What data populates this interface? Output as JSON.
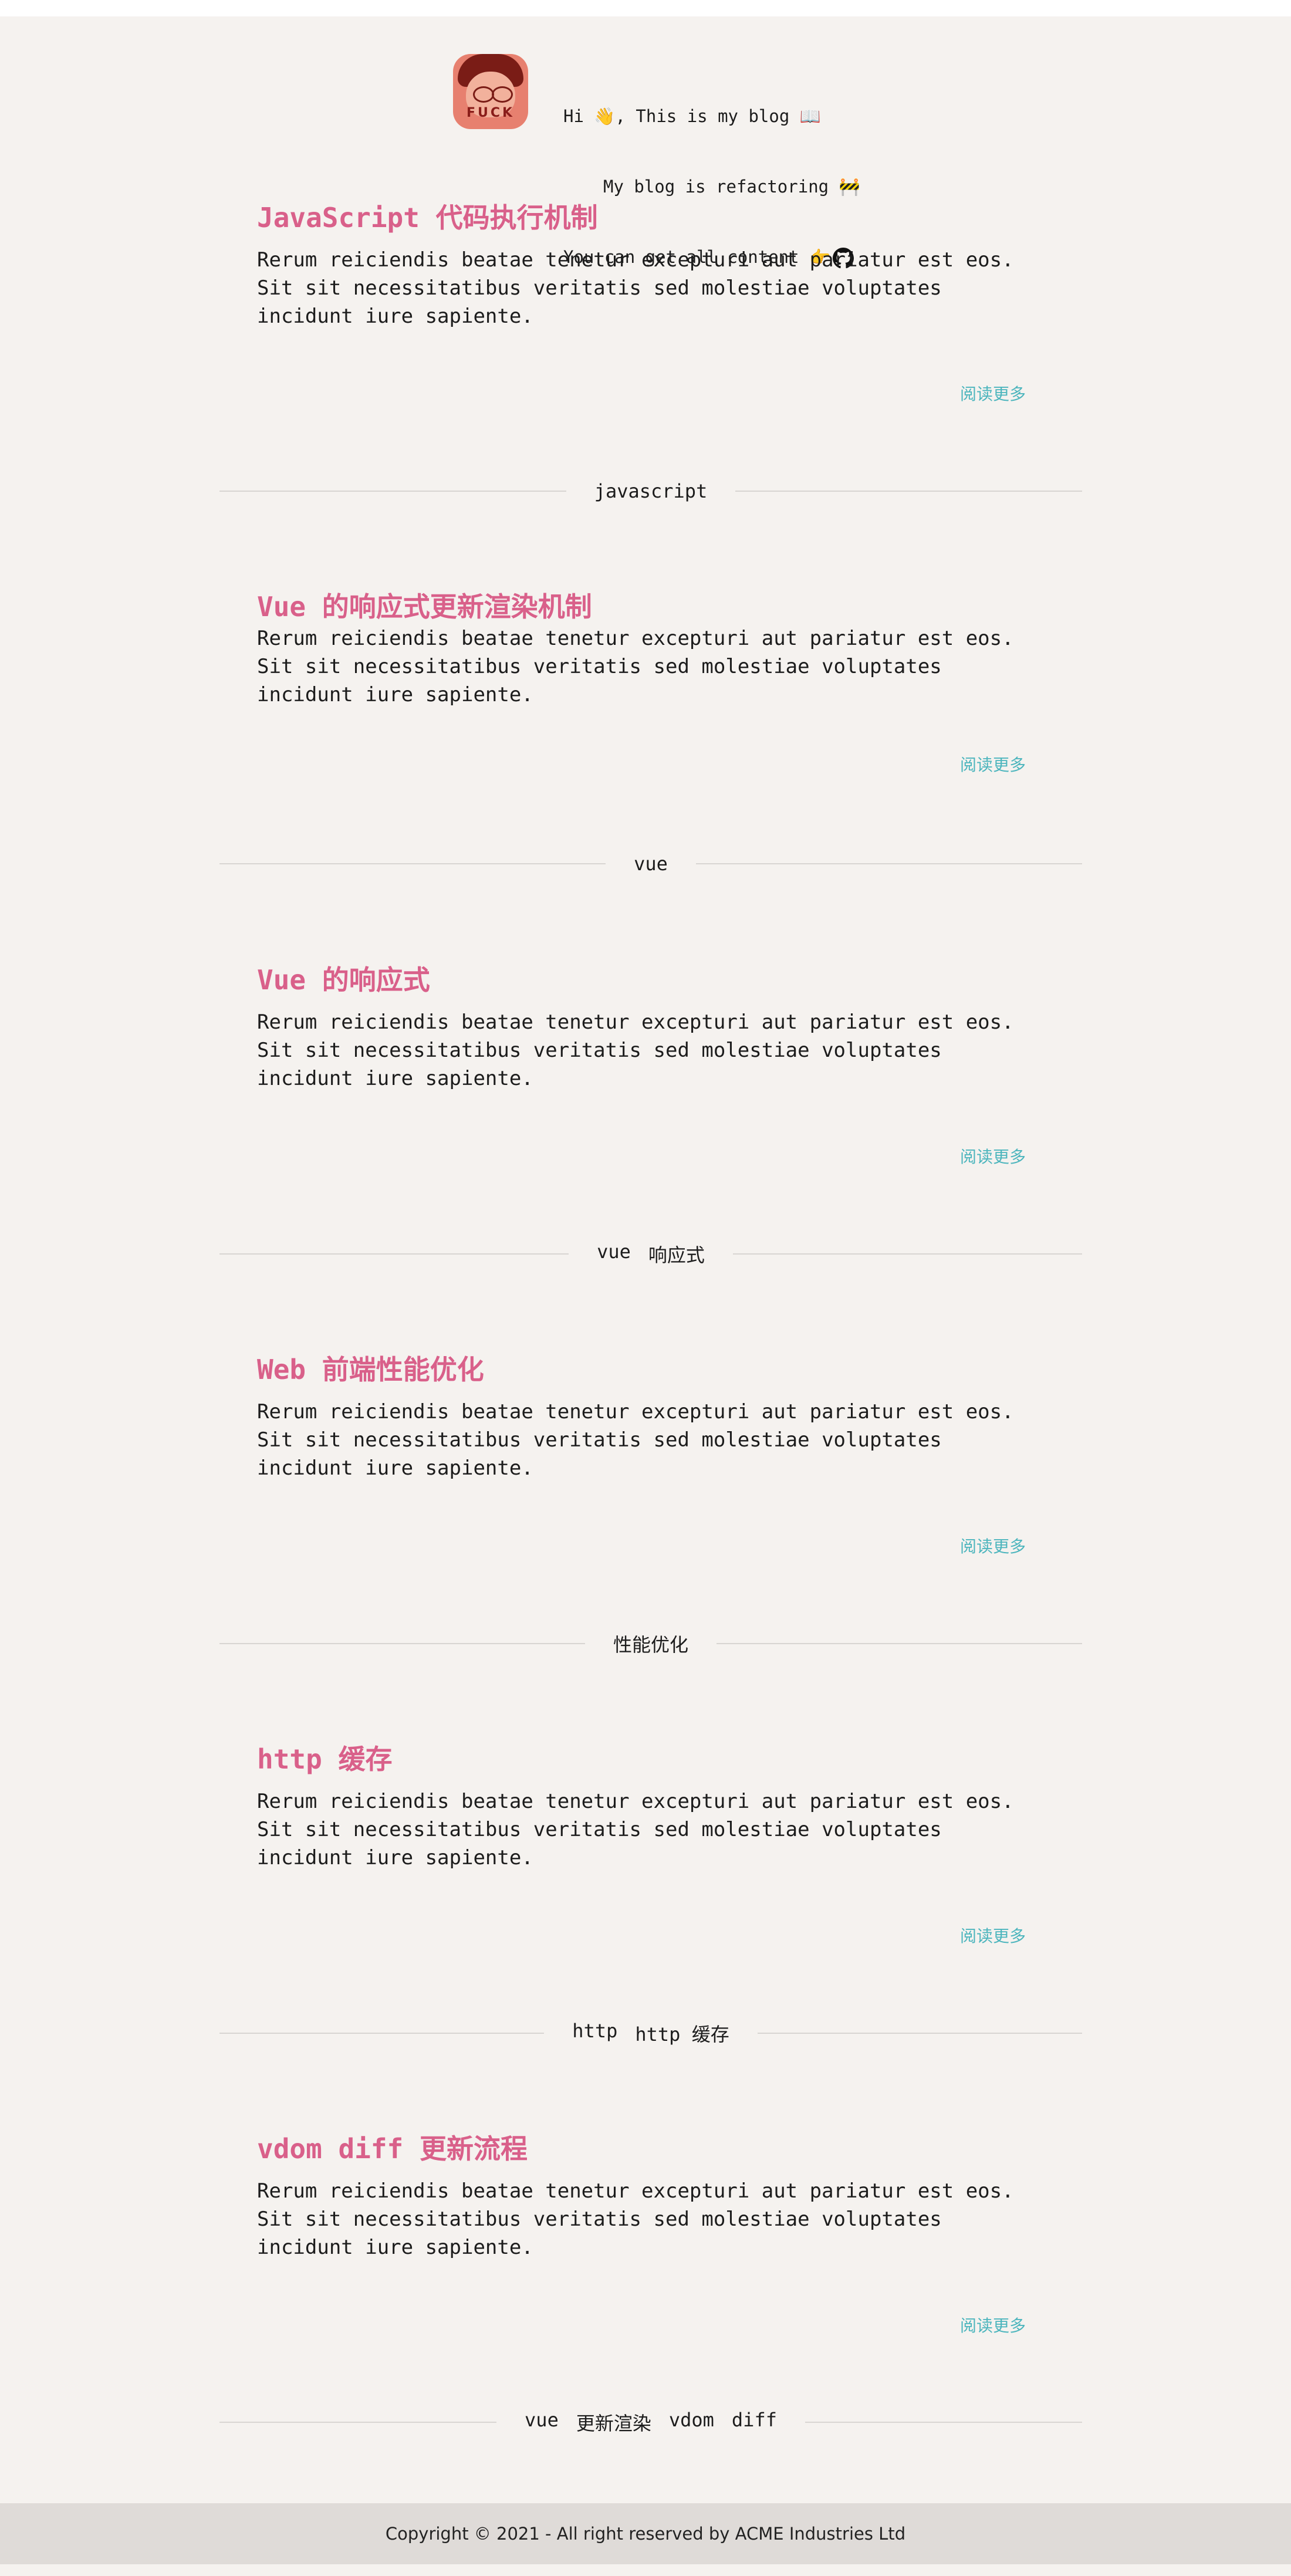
{
  "header": {
    "avatar_text": "FUCK",
    "intro_line1": "Hi 👋, This is my blog 📖",
    "intro_line2": "My blog is refactoring 🚧",
    "intro_line3": "You can get all content 👉"
  },
  "posts": [
    {
      "title": "JavaScript 代码执行机制",
      "excerpt": "Rerum reiciendis beatae tenetur excepturi aut pariatur est eos. Sit sit necessitatibus veritatis sed molestiae voluptates incidunt iure sapiente.",
      "read_more": "阅读更多",
      "tags": [
        "javascript"
      ]
    },
    {
      "title": "Vue 的响应式更新渲染机制",
      "excerpt": "Rerum reiciendis beatae tenetur excepturi aut pariatur est eos. Sit sit necessitatibus veritatis sed molestiae voluptates incidunt iure sapiente.",
      "read_more": "阅读更多",
      "tags": [
        "vue"
      ]
    },
    {
      "title": "Vue 的响应式",
      "excerpt": "Rerum reiciendis beatae tenetur excepturi aut pariatur est eos. Sit sit necessitatibus veritatis sed molestiae voluptates incidunt iure sapiente.",
      "read_more": "阅读更多",
      "tags": [
        "vue",
        "响应式"
      ]
    },
    {
      "title": "Web 前端性能优化",
      "excerpt": "Rerum reiciendis beatae tenetur excepturi aut pariatur est eos. Sit sit necessitatibus veritatis sed molestiae voluptates incidunt iure sapiente.",
      "read_more": "阅读更多",
      "tags": [
        "性能优化"
      ]
    },
    {
      "title": "http 缓存",
      "excerpt": "Rerum reiciendis beatae tenetur excepturi aut pariatur est eos. Sit sit necessitatibus veritatis sed molestiae voluptates incidunt iure sapiente.",
      "read_more": "阅读更多",
      "tags": [
        "http",
        "http 缓存"
      ]
    },
    {
      "title": "vdom diff 更新流程",
      "excerpt": "Rerum reiciendis beatae tenetur excepturi aut pariatur est eos. Sit sit necessitatibus veritatis sed molestiae voluptates incidunt iure sapiente.",
      "read_more": "阅读更多",
      "tags": [
        "vue",
        "更新渲染",
        "vdom",
        "diff"
      ]
    }
  ],
  "footer": {
    "copyright": "Copyright © 2021 - All right reserved by ACME Industries Ltd"
  },
  "colors": {
    "title": "#d9608a",
    "link": "#4cb5bd",
    "background": "#f5f2ef",
    "footer": "#dfdbd8"
  }
}
